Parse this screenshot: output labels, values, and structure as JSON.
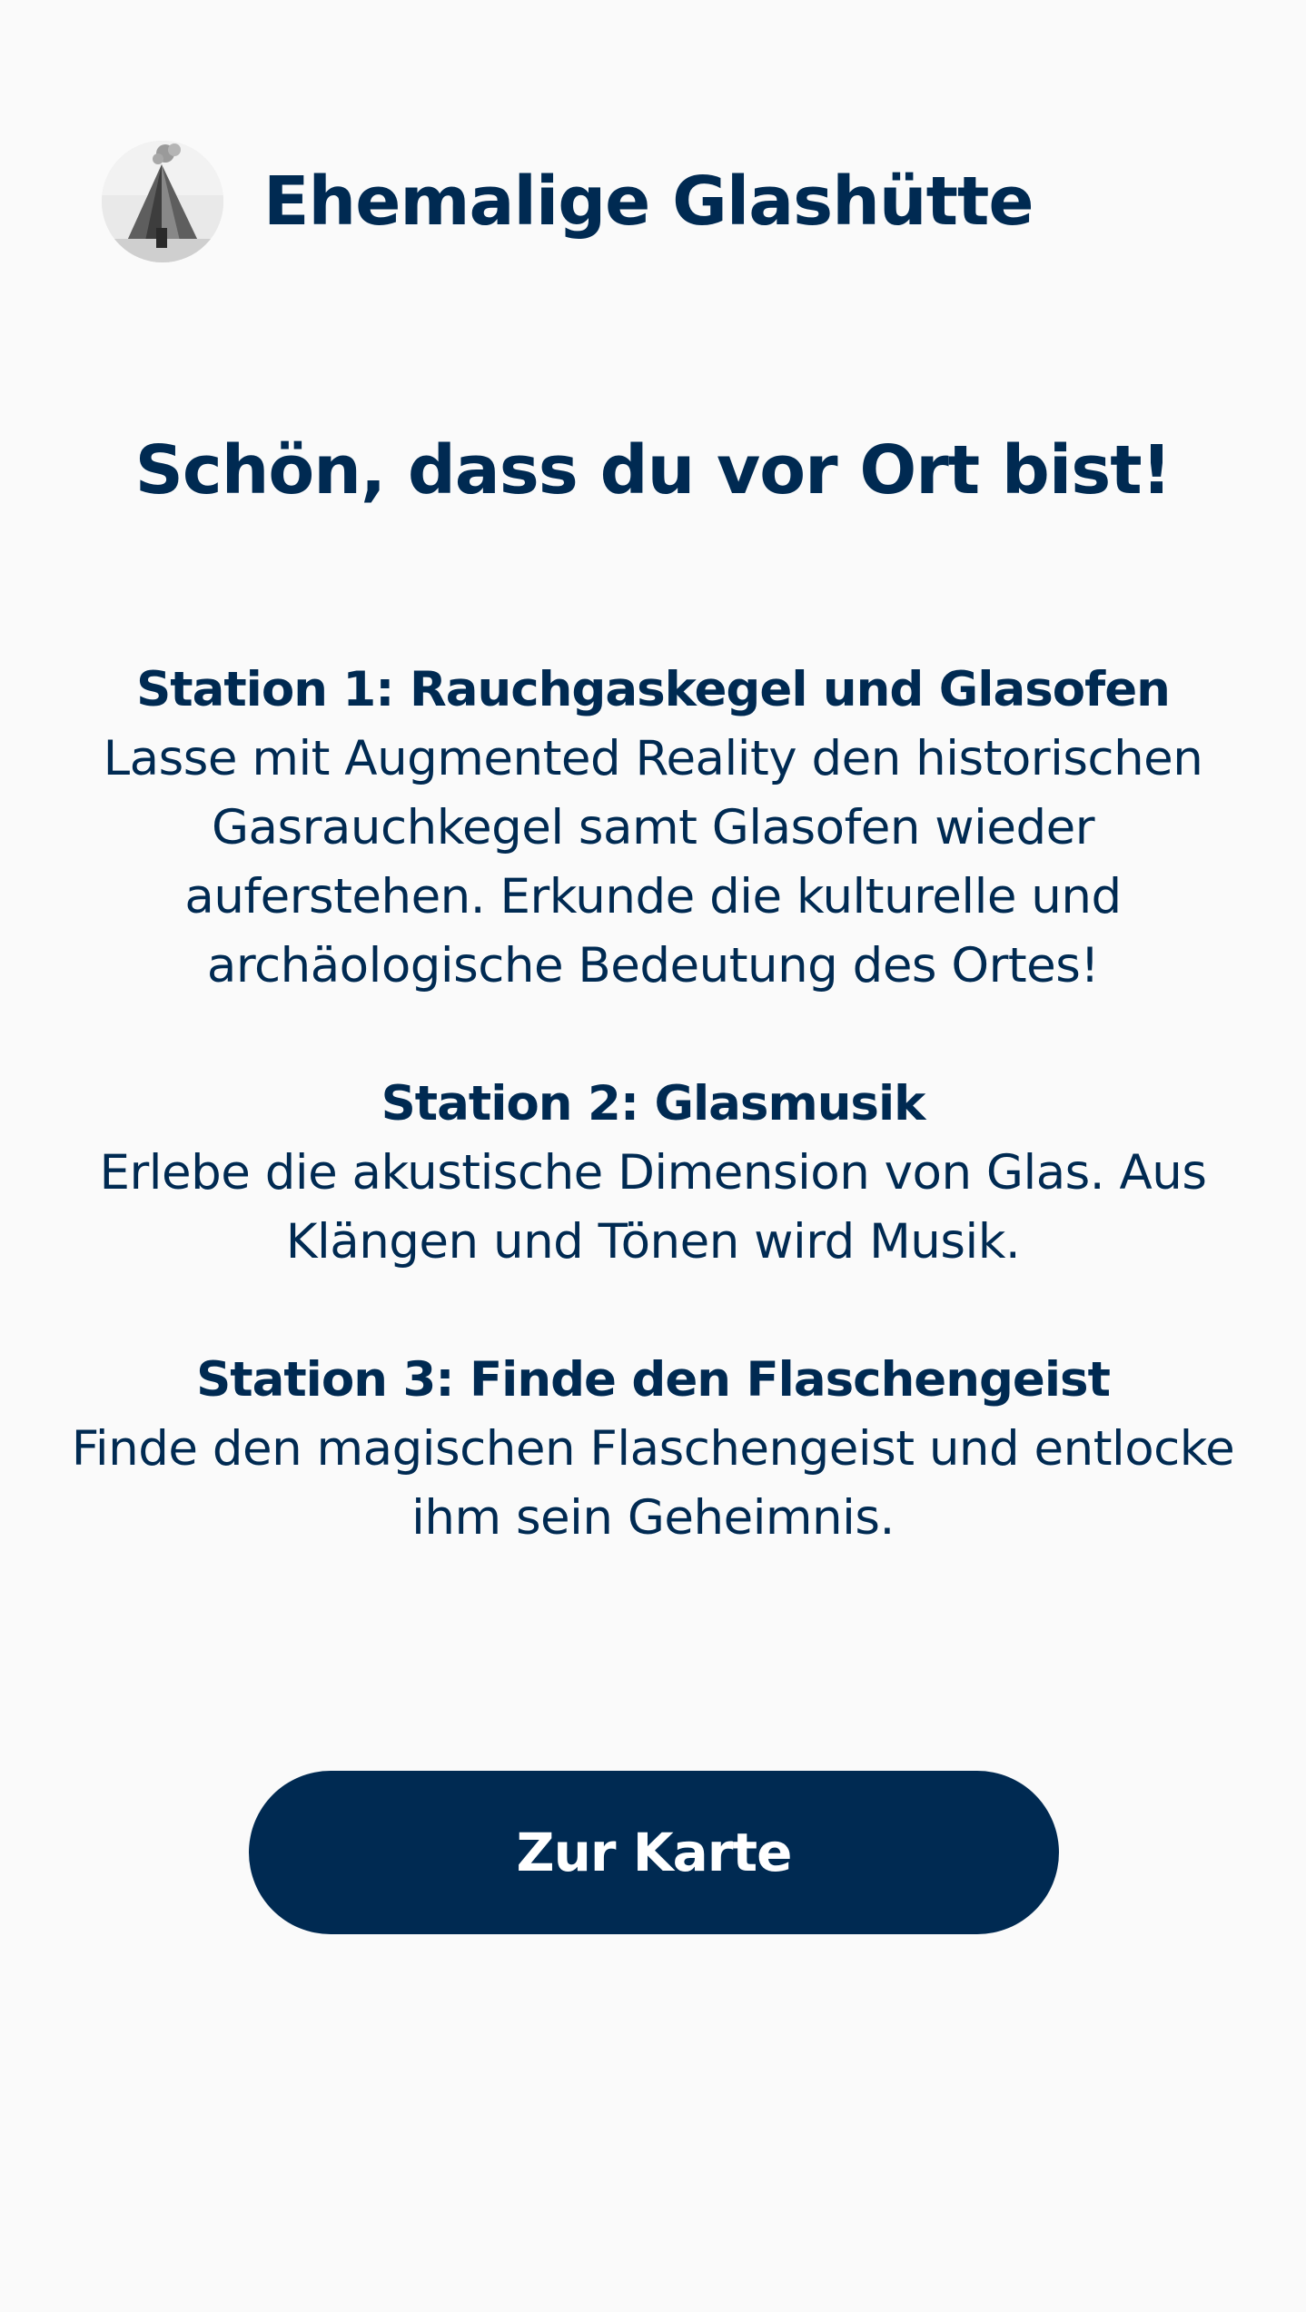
{
  "header": {
    "title": "Ehemalige Glashütte"
  },
  "greeting": "Schön, dass du vor Ort bist!",
  "stations": [
    {
      "title": "Station 1: Rauchgaskegel und Glasofen",
      "description": "Lasse mit Augmented Reality den historischen Gasrauchkegel samt Glasofen wieder auferstehen. Erkunde die kulturelle und archäologische Bedeutung des Ortes!"
    },
    {
      "title": "Station 2: Glasmusik",
      "description": "Erlebe die akustische Dimension von Glas. Aus Klängen und Tönen wird Musik."
    },
    {
      "title": "Station 3: Finde den Flaschengeist",
      "description": "Finde den magischen Flaschengeist und entlocke ihm sein Geheimnis."
    }
  ],
  "cta": {
    "label": "Zur Karte"
  },
  "colors": {
    "primary": "#002a52",
    "background": "#fafafa",
    "button_text": "#ffffff"
  }
}
